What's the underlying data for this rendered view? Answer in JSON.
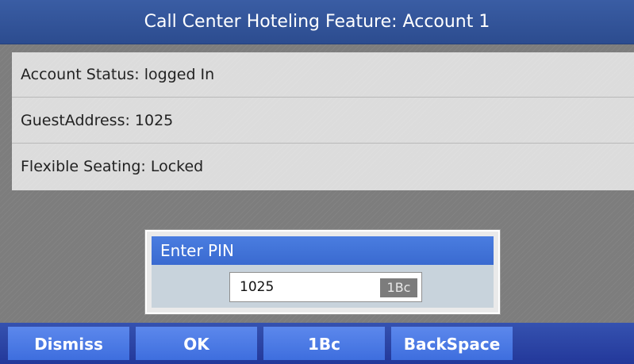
{
  "header": {
    "title": "Call Center Hoteling Feature: Account  1"
  },
  "info": {
    "rows": [
      {
        "text": "Account Status: logged In"
      },
      {
        "text": "GuestAddress: 1025"
      },
      {
        "text": "Flexible Seating: Locked"
      }
    ]
  },
  "pin_dialog": {
    "title": "Enter PIN",
    "value": "1025",
    "input_mode": "1Bc"
  },
  "softkeys": [
    {
      "label": "Dismiss"
    },
    {
      "label": "OK"
    },
    {
      "label": "1Bc"
    },
    {
      "label": "BackSpace"
    }
  ],
  "colors": {
    "title_bar": "#2f51a0",
    "dialog_header": "#4575dc",
    "softkey": "#4a78e4",
    "softkey_bar": "#2b44a4"
  }
}
